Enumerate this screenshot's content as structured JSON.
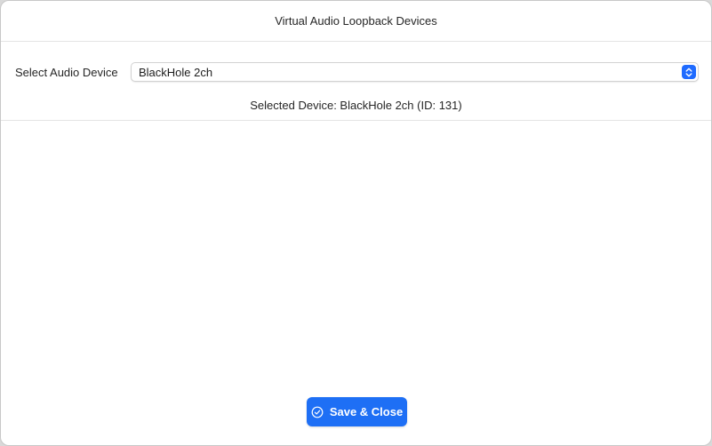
{
  "window": {
    "title": "Virtual Audio Loopback Devices"
  },
  "device_selector": {
    "label": "Select Audio Device",
    "selected_value": "BlackHole 2ch"
  },
  "selected_info": "Selected Device: BlackHole 2ch (ID: 131)",
  "footer": {
    "save_label": "Save & Close",
    "save_icon": "checkmark-circle-icon"
  },
  "colors": {
    "accent": "#1e6ff5",
    "background": "#ffffff",
    "divider": "#e4e4e4"
  }
}
